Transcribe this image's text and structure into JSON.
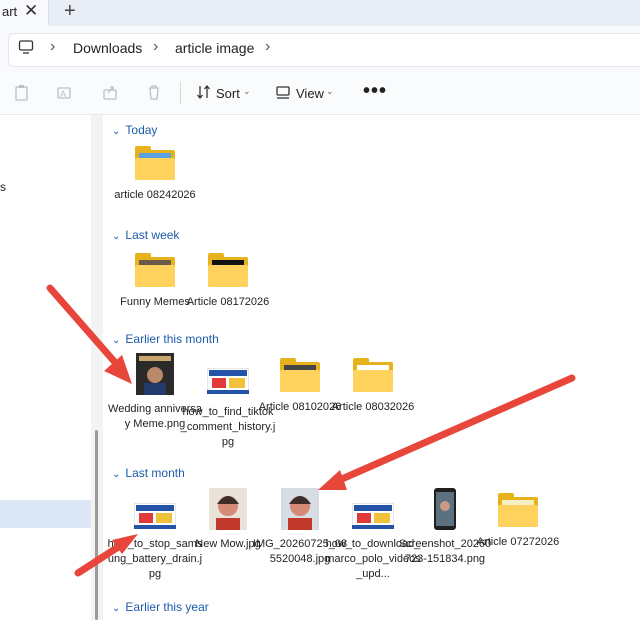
{
  "tab": {
    "title": "art",
    "close": "✕",
    "add": "+"
  },
  "breadcrumb": {
    "items": [
      "Downloads",
      "article image"
    ],
    "separator": "›"
  },
  "toolbar": {
    "sort_label": "Sort",
    "view_label": "View",
    "more": "•••",
    "caret": "⌄"
  },
  "nav": {
    "fragment": "s"
  },
  "groups": {
    "today": "Today",
    "last_week": "Last week",
    "earlier_this_month": "Earlier this month",
    "last_month": "Last month",
    "earlier_this_year": "Earlier this year"
  },
  "chevron": "⌄",
  "files": {
    "today": [
      {
        "name": "article 08242026",
        "type": "folder"
      }
    ],
    "last_week": [
      {
        "name": "Funny Memes",
        "type": "folder"
      },
      {
        "name": "Article 08172026",
        "type": "folder"
      }
    ],
    "earlier_this_month": [
      {
        "name": "Wedding anniversay Meme.png",
        "type": "image"
      },
      {
        "name": "how_to_find_tiktok_comment_history.jpg",
        "type": "image"
      },
      {
        "name": "Article 08102026",
        "type": "folder"
      },
      {
        "name": "Article 08032026",
        "type": "folder"
      }
    ],
    "last_month": [
      {
        "name": "how_to_stop_samsung_battery_drain.jpg",
        "type": "image"
      },
      {
        "name": "New Mow.jpg",
        "type": "image"
      },
      {
        "name": "IMG_20260725_085520048.jpg",
        "type": "image"
      },
      {
        "name": "how_to_download_marco_polo_videos_upd...",
        "type": "image"
      },
      {
        "name": "Screenshot_20260723-151834.png",
        "type": "image"
      },
      {
        "name": "Article 07272026",
        "type": "folder"
      }
    ]
  },
  "colors": {
    "accent": "#1d5bab",
    "arrow": "#e8463a",
    "folder": "#ffd25e",
    "selection": "#dce8f6"
  }
}
